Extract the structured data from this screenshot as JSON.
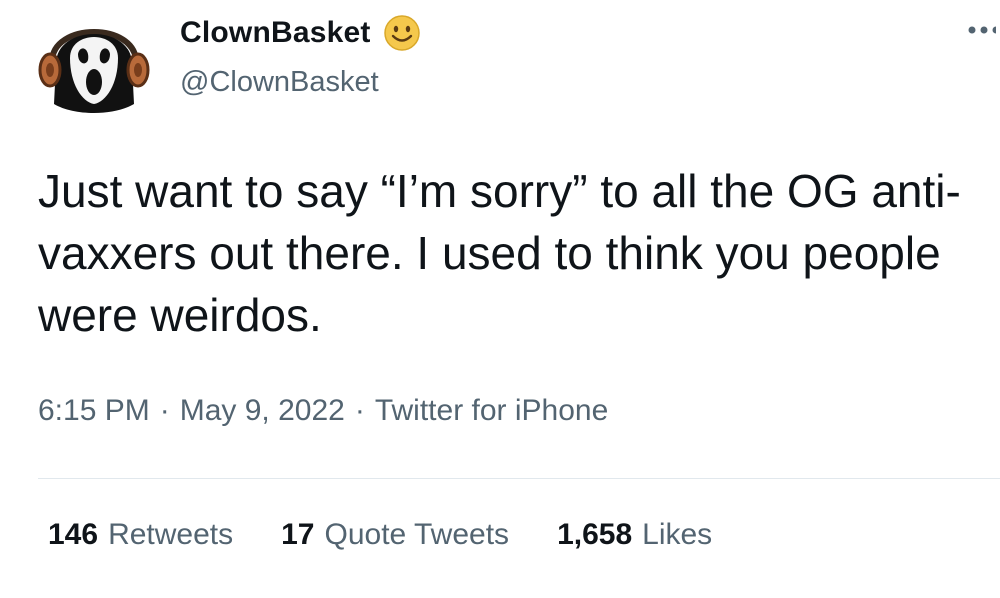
{
  "user": {
    "display_name": "ClownBasket",
    "handle": "@ClownBasket",
    "avatar_icon": "ghostface-with-headphones-avatar",
    "badge_icon": "smiley-face-emoji-icon"
  },
  "header": {
    "more_icon": "more-dots-icon"
  },
  "tweet": {
    "text": "Just want to say “I’m sorry” to all the OG anti-vaxxers out there. I used to think you people were weirdos."
  },
  "meta": {
    "time": "6:15 PM",
    "separator": "·",
    "date": "May 9, 2022",
    "source": "Twitter for iPhone"
  },
  "stats": {
    "retweets_count": "146",
    "retweets_label": "Retweets",
    "quotes_count": "17",
    "quotes_label": "Quote Tweets",
    "likes_count": "1,658",
    "likes_label": "Likes"
  },
  "colors": {
    "text_primary": "#0f1419",
    "text_secondary": "#536471",
    "divider": "#e1e8ed",
    "emoji_yellow": "#f5c84c"
  }
}
